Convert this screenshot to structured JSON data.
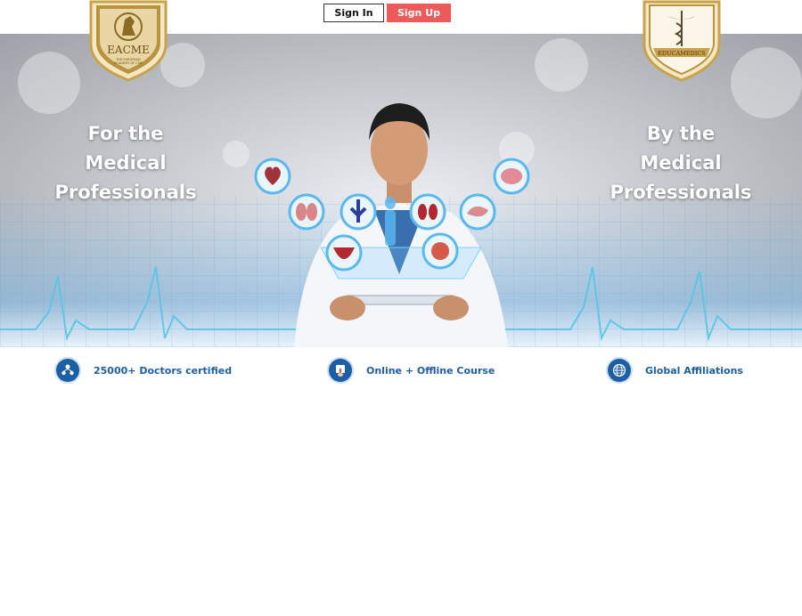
{
  "header": {
    "signin_label": "Sign In",
    "signup_label": "Sign Up",
    "signup_color": "#ec5a5a"
  },
  "logos": {
    "left": {
      "name": "EACME",
      "subtitle": "THE EUROPEAN ACADEMY OF CME"
    },
    "right": {
      "name": "EDUCAMEDICS"
    }
  },
  "hero": {
    "left_line1": "For the",
    "left_line2": "Medical",
    "left_line3": "Professionals",
    "right_line1": "By the",
    "right_line2": "Medical",
    "right_line3": "Professionals"
  },
  "features": [
    {
      "icon": "doctors-network-icon",
      "label": "25000+ Doctors certified"
    },
    {
      "icon": "touch-hand-icon",
      "label": "Online + Offline Course"
    },
    {
      "icon": "globe-icon",
      "label": "Global Affiliations"
    }
  ],
  "colors": {
    "accent": "#1d5fa6",
    "gold": "#c9a24b"
  }
}
